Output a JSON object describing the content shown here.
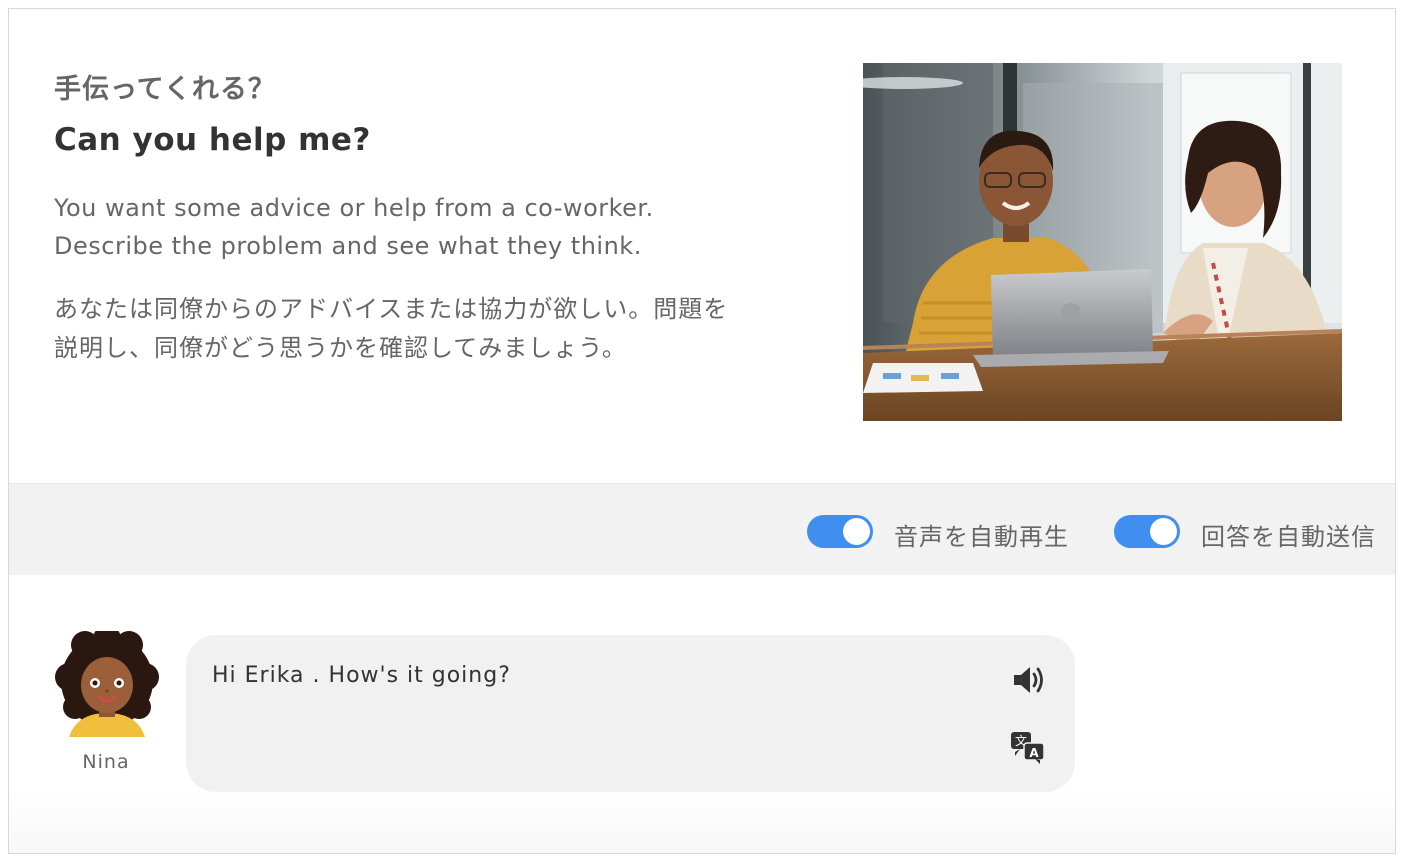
{
  "intro": {
    "title_jp": "手伝ってくれる？",
    "title_en": "Can you help me?",
    "description_en": "You want some advice or help from a co-worker.\nDescribe the problem and see what they think.",
    "description_jp": "あなたは同僚からのアドバイスまたは協力が欲しい。問題を\n説明し、同僚がどう思うかを確認してみましょう。"
  },
  "settings": {
    "autoplay_audio": {
      "label": "音声を自動再生",
      "enabled": true
    },
    "auto_submit": {
      "label": "回答を自動送信",
      "enabled": true
    }
  },
  "chat": {
    "messages": [
      {
        "speaker": "Nina",
        "text": "Hi Erika . How's it going?",
        "icons": [
          "speaker-icon",
          "translate-icon"
        ]
      }
    ]
  },
  "colors": {
    "toggle_on": "#3f8ef0",
    "bubble_bg": "#f1f1f1",
    "bar_bg": "#f2f2f2"
  }
}
